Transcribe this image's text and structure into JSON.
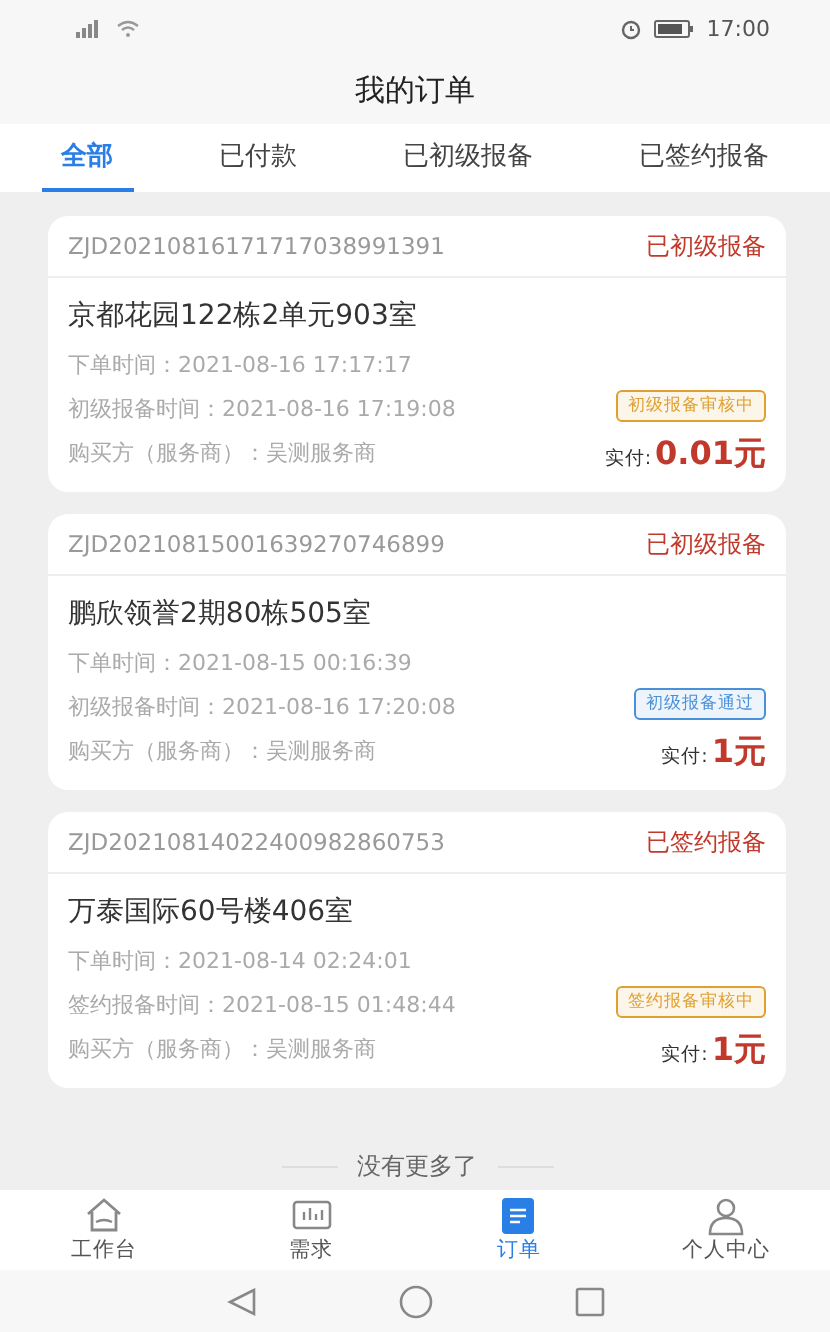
{
  "status_bar": {
    "time": "17:00"
  },
  "header": {
    "title": "我的订单"
  },
  "tabs": [
    {
      "label": "全部",
      "selected": true
    },
    {
      "label": "已付款",
      "selected": false
    },
    {
      "label": "已初级报备",
      "selected": false
    },
    {
      "label": "已签约报备",
      "selected": false
    }
  ],
  "orders": [
    {
      "order_no": "ZJD20210816171717038991391",
      "status": "已初级报备",
      "address": "京都花园122栋2单元903室",
      "lines": [
        "下单时间：2021-08-16 17:17:17",
        "初级报备时间：2021-08-16 17:19:08",
        "购买方（服务商）：吴测服务商"
      ],
      "tag": {
        "label": "初级报备审核中",
        "color": "#e0a030"
      },
      "paid_label": "实付:",
      "price": "0.01元"
    },
    {
      "order_no": "ZJD20210815001639270746899",
      "status": "已初级报备",
      "address": "鹏欣领誉2期80栋505室",
      "lines": [
        "下单时间：2021-08-15 00:16:39",
        "初级报备时间：2021-08-16 17:20:08",
        "购买方（服务商）：吴测服务商"
      ],
      "tag": {
        "label": "初级报备通过",
        "color": "#4a90d9"
      },
      "paid_label": "实付:",
      "price": "1元"
    },
    {
      "order_no": "ZJD20210814022400982860753",
      "status": "已签约报备",
      "address": "万泰国际60号楼406室",
      "lines": [
        "下单时间：2021-08-14 02:24:01",
        "签约报备时间：2021-08-15 01:48:44",
        "购买方（服务商）：吴测服务商"
      ],
      "tag": {
        "label": "签约报备审核中",
        "color": "#e0a030"
      },
      "paid_label": "实付:",
      "price": "1元"
    }
  ],
  "end_text": "没有更多了",
  "nav": [
    {
      "kind": "home",
      "label": "工作台",
      "selected": false
    },
    {
      "kind": "chart",
      "label": "需求",
      "selected": false
    },
    {
      "kind": "list",
      "label": "订单",
      "selected": true
    },
    {
      "kind": "person",
      "label": "个人中心",
      "selected": false
    }
  ]
}
